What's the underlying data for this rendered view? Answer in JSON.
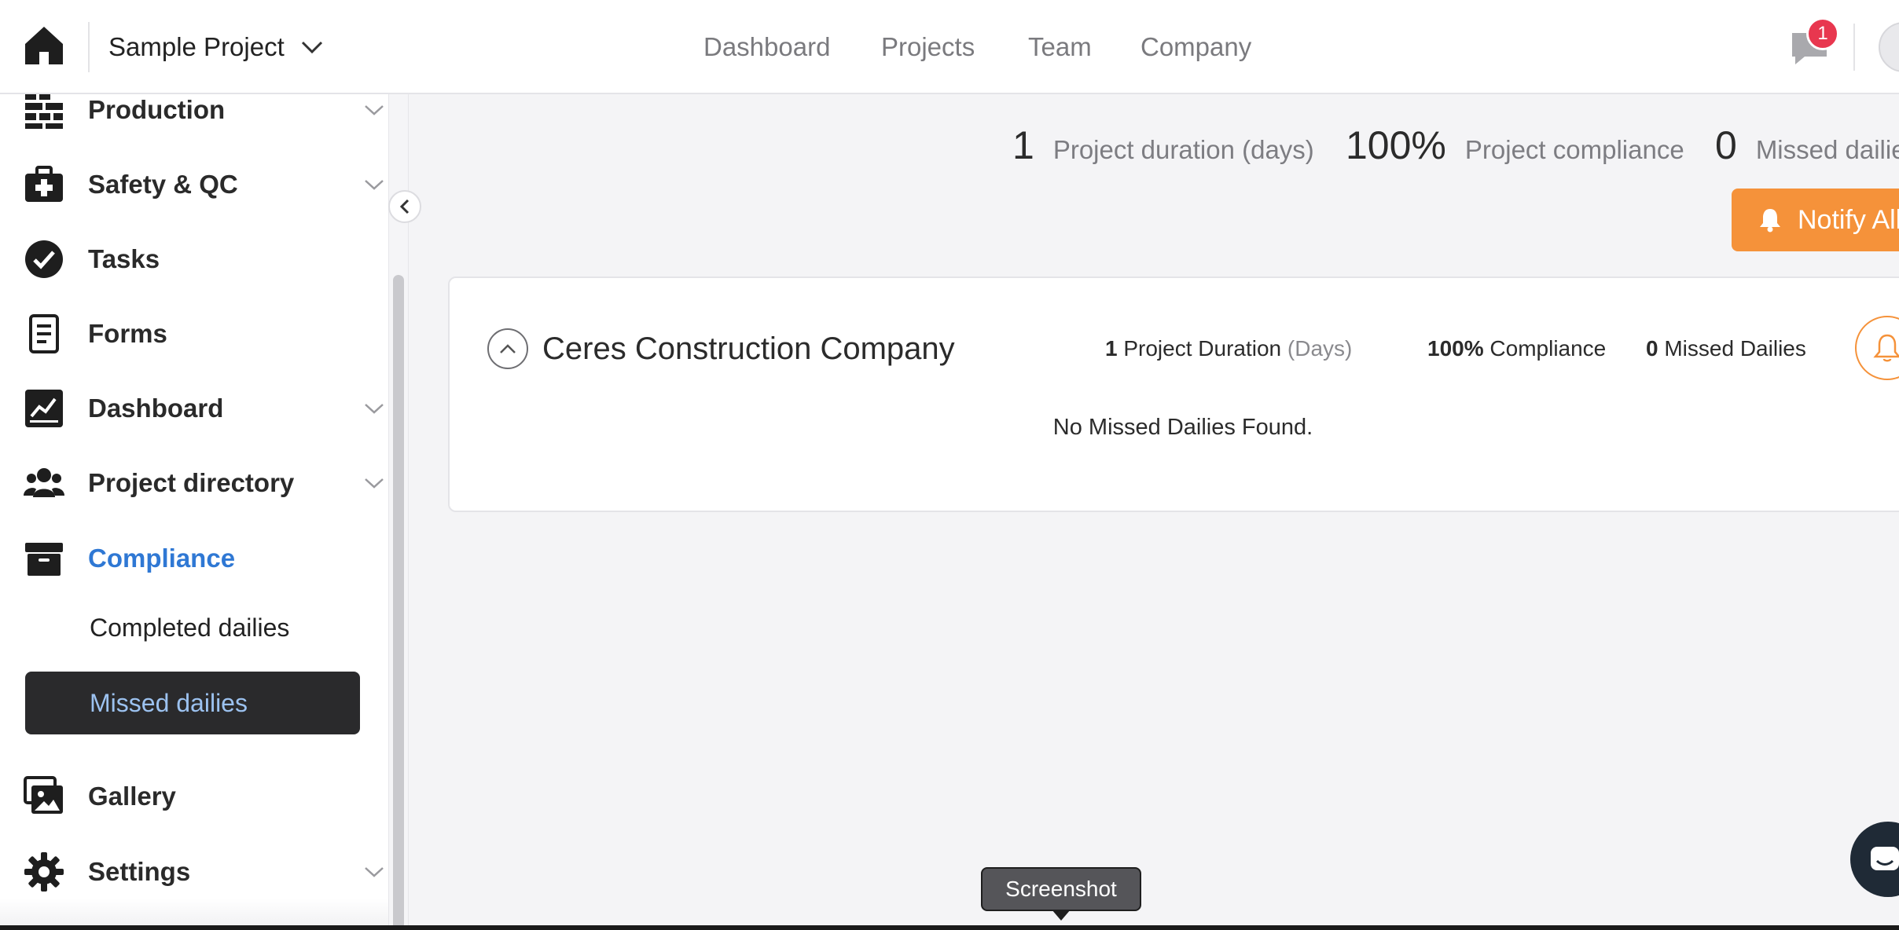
{
  "topbar": {
    "project_name": "Sample Project",
    "nav": {
      "dashboard": "Dashboard",
      "projects": "Projects",
      "team": "Team",
      "company": "Company"
    },
    "notification_count": "1"
  },
  "sidebar": {
    "items": {
      "production": "Production",
      "safety_qc": "Safety & QC",
      "tasks": "Tasks",
      "forms": "Forms",
      "dashboard": "Dashboard",
      "project_directory": "Project directory",
      "compliance": "Compliance",
      "completed_dailies": "Completed dailies",
      "missed_dailies": "Missed dailies",
      "gallery": "Gallery",
      "settings": "Settings"
    }
  },
  "summary": {
    "duration_value": "1",
    "duration_label": "Project duration (days)",
    "compliance_value": "100%",
    "compliance_label": "Project compliance",
    "missed_value": "0",
    "missed_label": "Missed dailies"
  },
  "notify_all_label": "Notify All",
  "company_card": {
    "title": "Ceres Construction Company",
    "duration_value": "1",
    "duration_label": "Project Duration",
    "duration_unit": "(Days)",
    "compliance_value": "100%",
    "compliance_label": "Compliance",
    "missed_value": "0",
    "missed_label": "Missed Dailies",
    "empty_message": "No Missed Dailies Found."
  },
  "tooltip": "Screenshot",
  "colors": {
    "accent_orange": "#f5923a",
    "active_blue": "#2f78d4",
    "badge_red": "#e8374f",
    "selected_bg": "#2a2a2c"
  }
}
